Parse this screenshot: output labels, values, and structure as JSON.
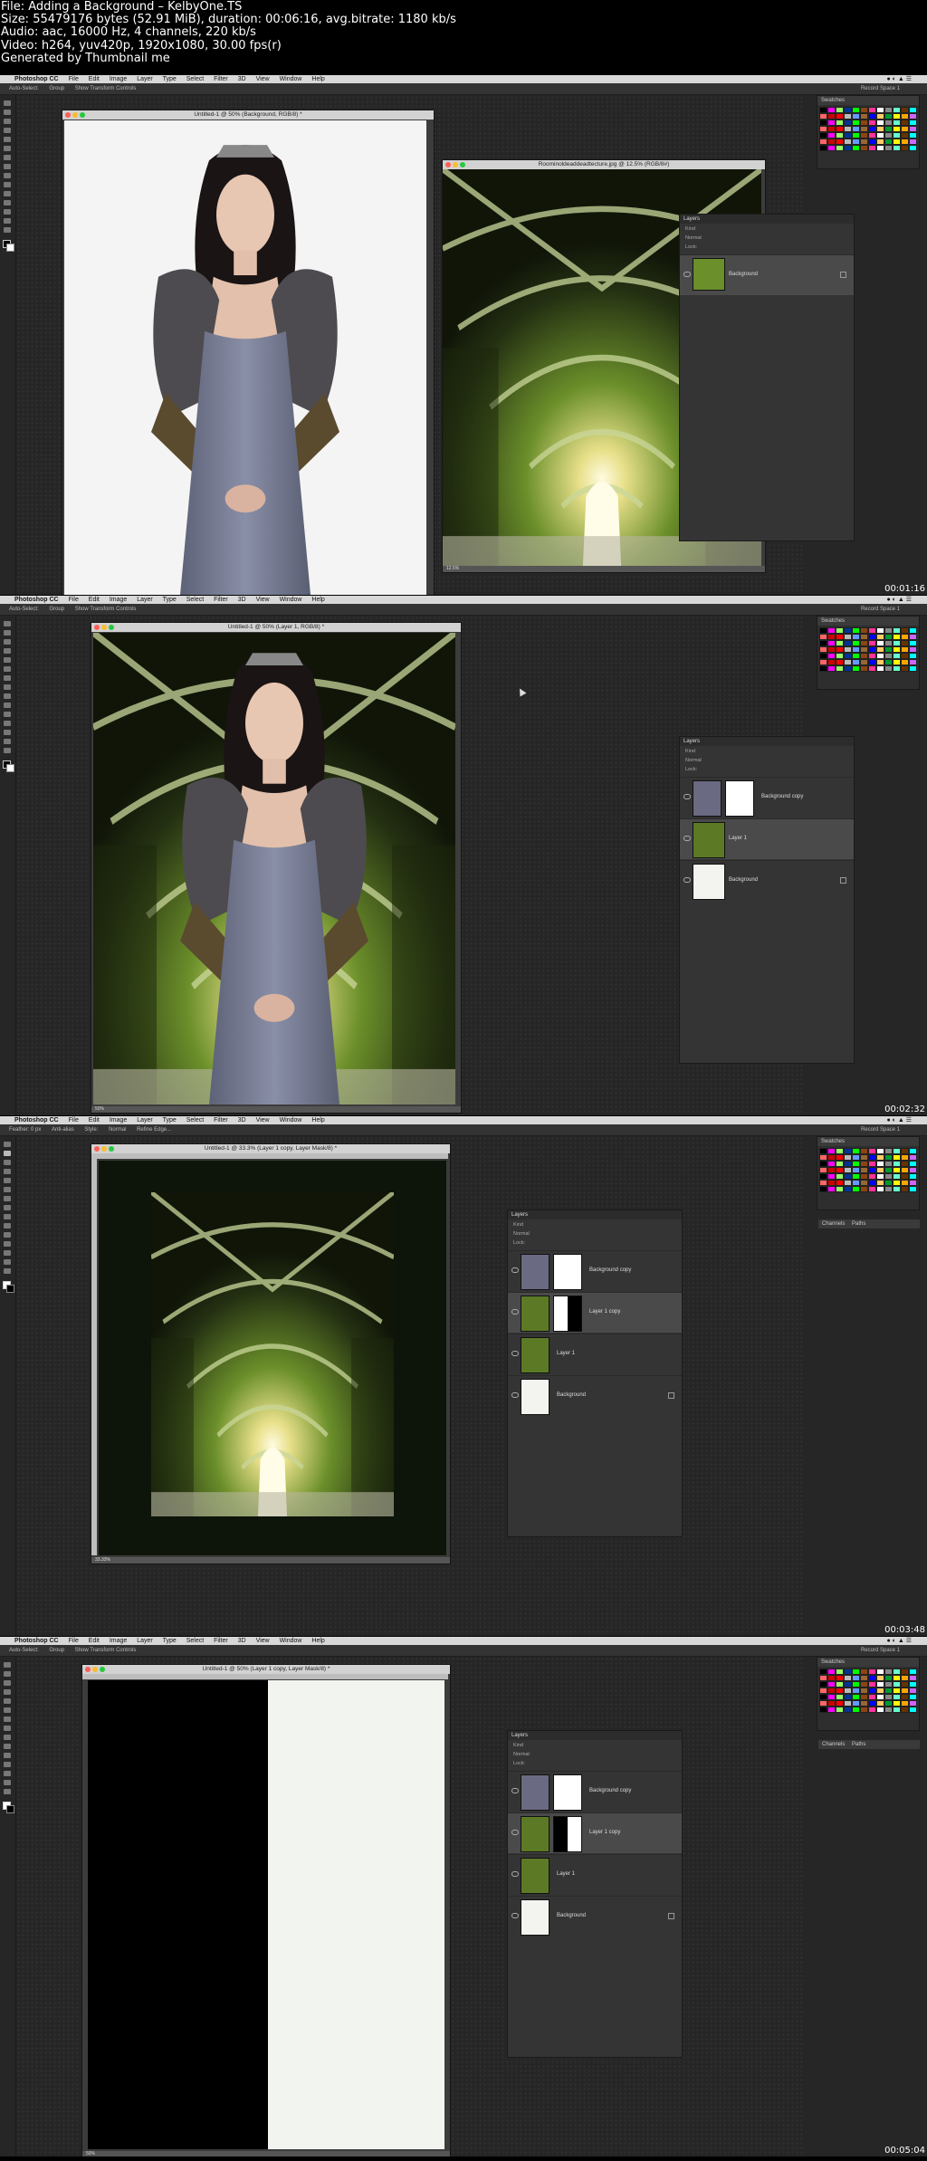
{
  "info": {
    "line1": "File: Adding a Background – KelbyOne.TS",
    "line2": "Size: 55479176 bytes (52.91 MiB), duration: 00:06:16, avg.bitrate: 1180 kb/s",
    "line3": "Audio: aac, 16000 Hz, 4 channels, 220 kb/s",
    "line4": "Video: h264, yuv420p, 1920x1080, 30.00 fps(r)",
    "line5": "Generated by Thumbnail me"
  },
  "menu": {
    "app": "Photoshop CC",
    "items": [
      "File",
      "Edit",
      "Image",
      "Layer",
      "Type",
      "Select",
      "Filter",
      "3D",
      "View",
      "Window",
      "Help"
    ]
  },
  "options": {
    "auto_select": "Auto-Select:",
    "group": "Group",
    "show_transform": "Show Transform Controls",
    "feather": "Feather: 0 px",
    "anti_alias": "Anti-alias",
    "style": "Style:",
    "style_val": "Normal",
    "refine": "Refine Edge...",
    "workspace": "Record Space 1"
  },
  "panels": {
    "swatches": "Swatches",
    "layers": "Layers",
    "channels": "Channels",
    "paths": "Paths",
    "kind": "Kind",
    "normal": "Normal",
    "opacity": "Opacity: 100%",
    "lock": "Lock:",
    "fill": "Fill: 100%"
  },
  "frames": [
    {
      "timestamp": "00:01:16",
      "doc1_title": "Untitled-1 @ 50% (Background, RGB/8) *",
      "doc2_title": "Roominoldeaddeadtecture.jpg @ 12.5% (RGB/8#)",
      "doc2_status": "12.5%",
      "layers": [
        "Background"
      ]
    },
    {
      "timestamp": "00:02:32",
      "doc1_title": "Untitled-1 @ 50% (Layer 1, RGB/8) *",
      "doc1_status": "50%",
      "layers": [
        "Background copy",
        "Layer 1",
        "Background"
      ]
    },
    {
      "timestamp": "00:03:48",
      "doc1_title": "Untitled-1 @ 33.3% (Layer 1 copy, Layer Mask/8) *",
      "doc1_status": "33.33%",
      "layers": [
        "Background copy",
        "Layer 1 copy",
        "Layer 1",
        "Background"
      ]
    },
    {
      "timestamp": "00:05:04",
      "doc1_title": "Untitled-1 @ 50% (Layer 1 copy, Layer Mask/8) *",
      "doc1_status": "50%",
      "layers": [
        "Background copy",
        "Layer 1 copy",
        "Layer 1",
        "Background"
      ]
    }
  ],
  "colors": {
    "workspace": "#262626",
    "tunnel_green": "#6b8f2a",
    "dress": "#7a7f99"
  }
}
